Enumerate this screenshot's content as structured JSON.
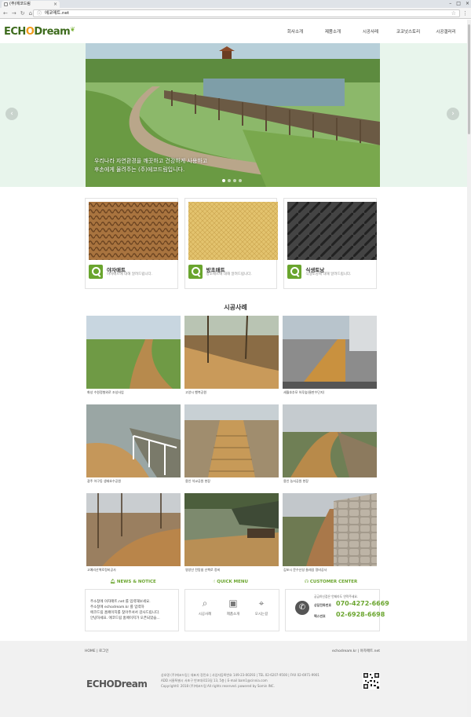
{
  "browser": {
    "tab_title": "(주)에코드림",
    "close": "×",
    "url": "에코매트.net",
    "window_controls": [
      "–",
      "□",
      "×"
    ]
  },
  "header": {
    "logo": "ECHODream",
    "nav": [
      "회사소개",
      "제품소개",
      "시공사례",
      "코코넛스토리",
      "시공갤러리"
    ]
  },
  "hero": {
    "caption_line1": "우리나라 자연환경을 깨끗하고 건강하게 사용하고",
    "caption_line2": "후손에게 물려주는 (주)에코드림입니다.",
    "arrow_prev": "‹",
    "arrow_next": "›",
    "slide_count": 4,
    "active_slide": 1
  },
  "products": [
    {
      "title": "야자매트",
      "desc": "야자매트에 대해 알려드립니다."
    },
    {
      "title": "방초매트",
      "desc": "방초매트에 대해 알려드립니다."
    },
    {
      "title": "식생토낭",
      "desc": "식생토낭에 대해 알려드립니다."
    }
  ],
  "cases": {
    "title": "시공사례",
    "items": [
      {
        "caption": "화성 수원정형외로 조성사업"
      },
      {
        "caption": "고양시 행복공원"
      },
      {
        "caption": "세월호추모 하루숲(물판수단지)"
      },
      {
        "caption": "광주 아구동 생태호수공원"
      },
      {
        "caption": "용인 석교공원 현장"
      },
      {
        "caption": "용인 농서공원 현장"
      },
      {
        "caption": "고예리산책로정비공사"
      },
      {
        "caption": "영양산 전망쉼 산책로 정비"
      },
      {
        "caption": "김포시 문수산성 둘레길 정비공사"
      }
    ]
  },
  "bottom": {
    "news_title": "NEWS & NOTICE",
    "news": [
      "주소창에 야자매트.net 를 입력해보세요.",
      "주소창에 echodream.kr 를 입력하",
      "에코드림 홈페이지를 찾아주셔서 감사드립니다.",
      "안녕하세요. 에코드림 홈페이지가 오픈되었습..."
    ],
    "quick_title": "QUICK MENU",
    "quick": [
      {
        "icon": "search-icon",
        "label": "시공사례"
      },
      {
        "icon": "image-icon",
        "label": "제품소개"
      },
      {
        "icon": "map-pin-icon",
        "label": "오시는길"
      }
    ],
    "center_title": "CUSTOMER CENTER",
    "center_sub": "궁금하신점은 언제라도 연락주세요.",
    "tel_label": "상담전화번호",
    "tel": "070-4272-6669",
    "fax_label": "팩스번호",
    "fax": "02-6928-6698"
  },
  "footer": {
    "links": "HOME | 로그인",
    "right_links": "echodream.kr | 야자매트.net",
    "logo": "ECHODream",
    "info1": "상호명 (주)에코드림 | 대표자 정민호 | 사업자등록번호 149-23-00293 | TEL 02-6207-9500 | FAX 02-6971-9901",
    "info2": "ADD 서울특별시 서초구 반포대로23길 13, 5층 | E-mail bam1@cinnia.com",
    "info3": "Copyright© 2018 (주)에코드림 All rights reserved. powered by Somin INC."
  },
  "colors": {
    "brand_green": "#6aa52e",
    "hero_bg": "#e8f5ec",
    "logo_orange": "#f19b1b"
  }
}
